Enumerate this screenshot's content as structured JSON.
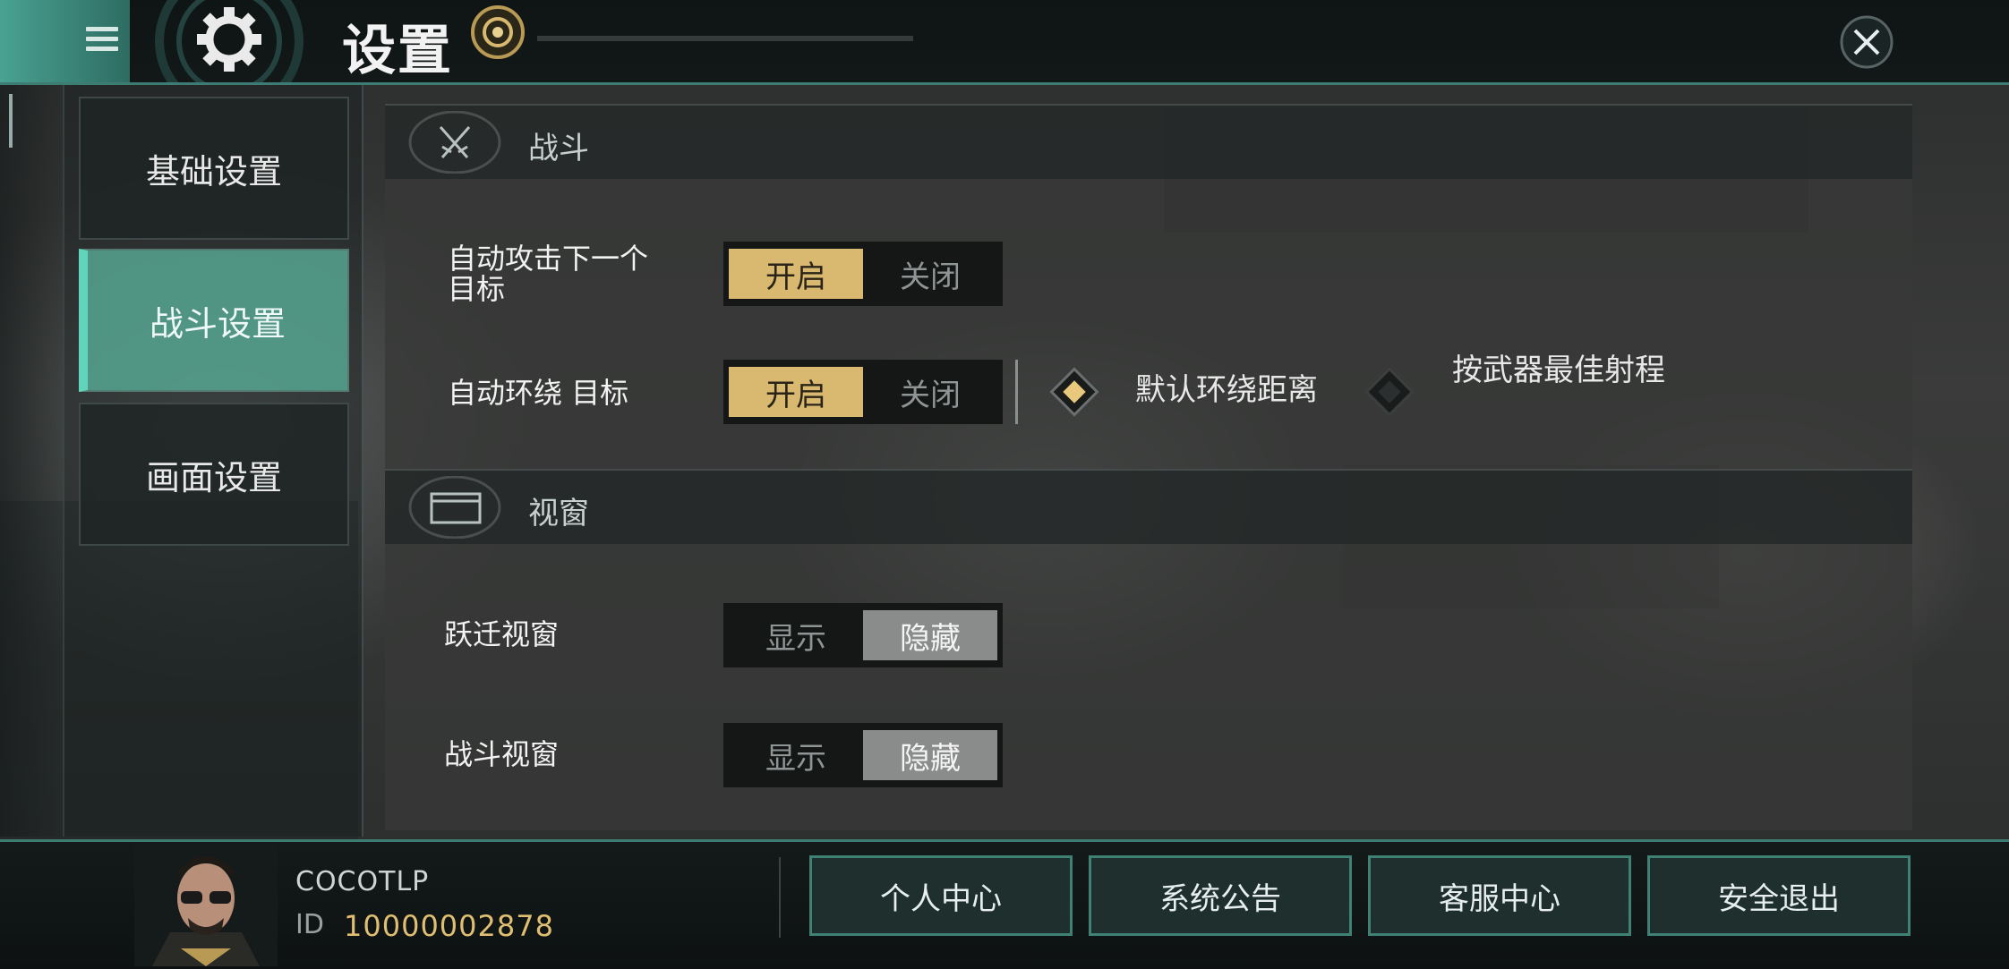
{
  "header": {
    "title": "设置",
    "menu_icon": "hamburger-menu-icon",
    "gear_icon": "gear-icon",
    "close_icon": "close-icon"
  },
  "sidebar": {
    "items": [
      {
        "label": "基础设置",
        "active": false
      },
      {
        "label": "战斗设置",
        "active": true
      },
      {
        "label": "画面设置",
        "active": false
      }
    ]
  },
  "sections": {
    "combat": {
      "title": "战斗",
      "icon": "crossed-swords-icon",
      "auto_attack": {
        "label": "自动攻击下一个目标",
        "on": "开启",
        "off": "关闭",
        "selected": "on"
      },
      "auto_orbit": {
        "label": "自动环绕 目标",
        "on": "开启",
        "off": "关闭",
        "selected": "on",
        "radio_default": "默认环绕距离",
        "radio_weapon": "按武器最佳射程",
        "radio_selected": "default"
      }
    },
    "window": {
      "title": "视窗",
      "icon": "window-icon",
      "warp_window": {
        "label": "跃迁视窗",
        "show": "显示",
        "hide": "隐藏",
        "selected": "hide"
      },
      "combat_window": {
        "label": "战斗视窗",
        "show": "显示",
        "hide": "隐藏",
        "selected": "hide"
      }
    }
  },
  "player": {
    "name": "COCOTLP",
    "id_label": "ID",
    "id": "10000002878"
  },
  "bottom_buttons": {
    "personal": "个人中心",
    "announce": "系统公告",
    "service": "客服中心",
    "logout": "安全退出"
  },
  "colors": {
    "accent": "#49a292",
    "gold": "#d9b86f",
    "border": "#3d7c72"
  }
}
